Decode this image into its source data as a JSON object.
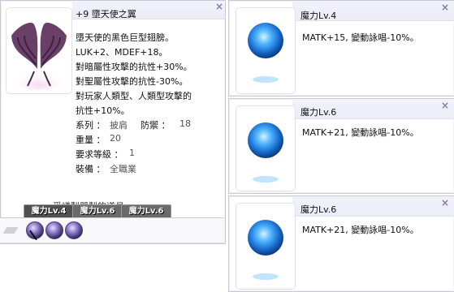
{
  "item_window": {
    "title": "+9 墮天使之翼",
    "description": [
      "墮天使的黑色巨型翅膀。",
      "LUK+2、MDEF+18。",
      "對暗屬性攻擊的抗性+30%。",
      "對聖屬性攻擊的抗性-30%。",
      "對玩家人類型、人類型攻擊的",
      "抗性+10%。"
    ],
    "stats": {
      "type_label": "系列 ：",
      "type_value": "披肩",
      "def_label": "防禦 ：",
      "def_value": "18",
      "weight_label": "重量 ：",
      "weight_value": "20",
      "level_label": "要求等級 ：",
      "level_value": "1",
      "equip_label": "裝備 ：",
      "equip_value": "全職業"
    },
    "footer_partial": "爭議製器製的道具",
    "tabs": [
      "魔力Lv.4",
      "魔力Lv.6",
      "魔力Lv.6"
    ],
    "close": "×"
  },
  "card_windows": [
    {
      "title": "魔力Lv.4",
      "effect": "MATK+15, 變動詠唱-10%。",
      "close": "×"
    },
    {
      "title": "魔力Lv.6",
      "effect": "MATK+21, 變動詠唱-10%。",
      "close": "×"
    },
    {
      "title": "魔力Lv.6",
      "effect": "MATK+21, 變動詠唱-10%。",
      "close": "×"
    }
  ],
  "colors": {
    "title_bar": "#ececf7",
    "close_icon": "#7c7cab",
    "orb_blue": "#2a8cf0",
    "wing_purple": "#6b3a6b"
  },
  "icons": {
    "item_image": "fallen-angel-wings-icon",
    "card_image": "blue-magic-orb-icon",
    "slot": "purple-orb-icon"
  }
}
